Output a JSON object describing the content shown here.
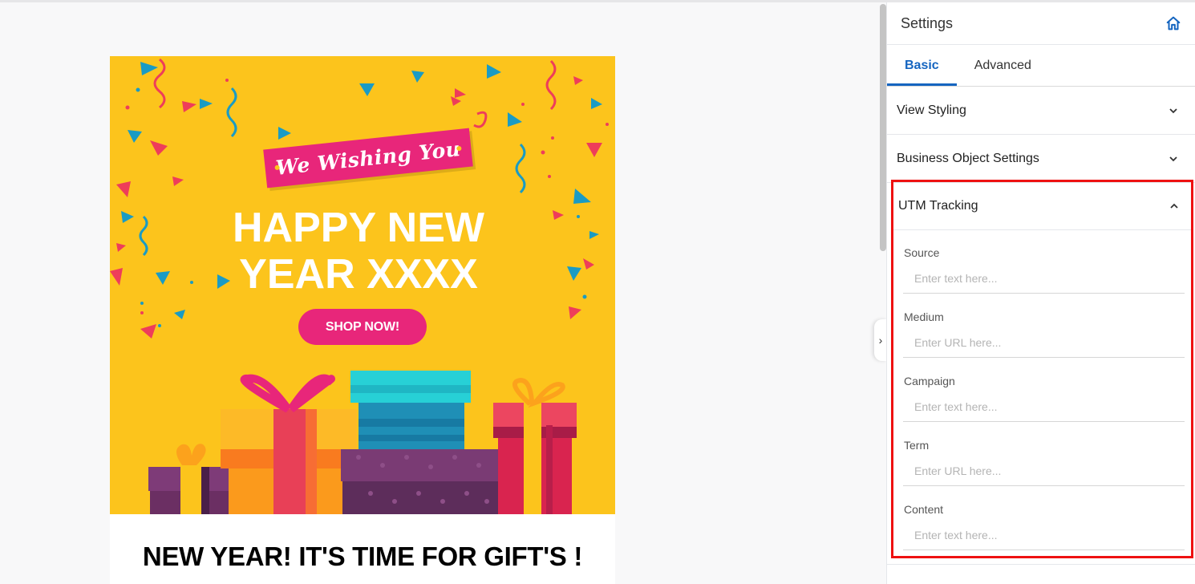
{
  "email": {
    "ribbon_text": "We Wishing You",
    "headline_line1": "HAPPY NEW",
    "headline_line2": "YEAR XXXX",
    "cta_label": "SHOP NOW!",
    "section_title": "NEW YEAR! IT'S TIME FOR GIFT'S !"
  },
  "settings": {
    "title": "Settings",
    "home_icon": "home-icon",
    "tabs": [
      {
        "label": "Basic",
        "active": true
      },
      {
        "label": "Advanced",
        "active": false
      }
    ],
    "sections": [
      {
        "label": "View Styling",
        "expanded": false
      },
      {
        "label": "Business Object Settings",
        "expanded": false
      },
      {
        "label": "UTM Tracking",
        "expanded": true
      }
    ],
    "utm_fields": [
      {
        "label": "Source",
        "placeholder": "Enter text here..."
      },
      {
        "label": "Medium",
        "placeholder": "Enter URL here..."
      },
      {
        "label": "Campaign",
        "placeholder": "Enter text here..."
      },
      {
        "label": "Term",
        "placeholder": "Enter URL here..."
      },
      {
        "label": "Content",
        "placeholder": "Enter text here..."
      }
    ]
  },
  "colors": {
    "accent": "#1565c0",
    "banner": "#fcc41c",
    "cta": "#e8267a",
    "highlight": "#ee1111"
  }
}
